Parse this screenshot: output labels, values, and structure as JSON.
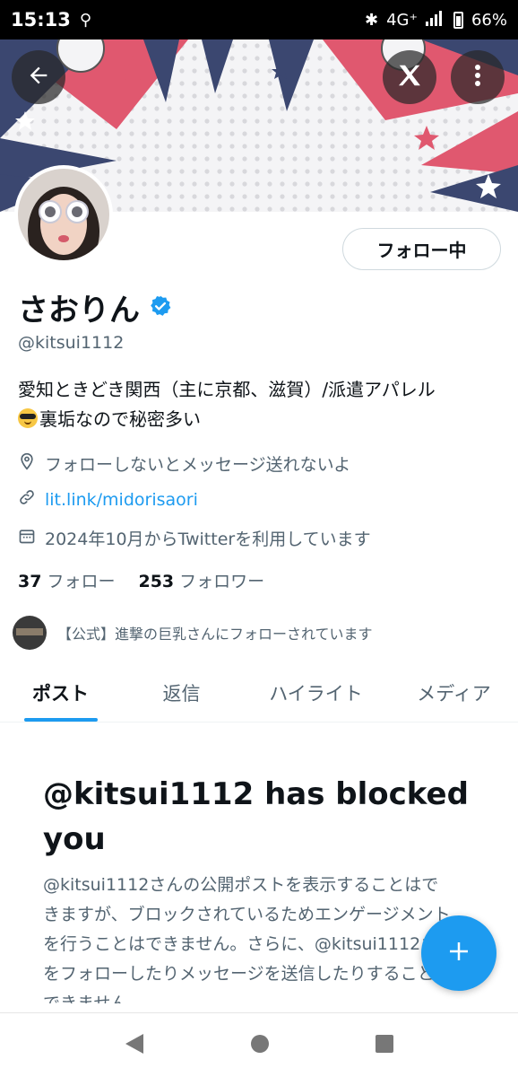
{
  "status_bar": {
    "time": "15:13",
    "network": "4G⁺",
    "battery": "66%"
  },
  "profile": {
    "name": "さおりん",
    "handle": "@kitsui1112",
    "follow_button": "フォロー中",
    "bio_line1": "愛知ときどき関西（主に京都、滋賀）/派遣アパレル",
    "bio_line2": "裏垢なので秘密多い",
    "location": "フォローしないとメッセージ送れないよ",
    "link": "lit.link/midorisaori",
    "joined": "2024年10月からTwitterを利用しています",
    "following_count": "37",
    "following_label": "フォロー",
    "followers_count": "253",
    "followers_label": "フォロワー",
    "followed_by": "【公式】進撃の巨乳さんにフォローされています"
  },
  "tabs": [
    {
      "label": "ポスト",
      "active": true
    },
    {
      "label": "返信",
      "active": false
    },
    {
      "label": "ハイライト",
      "active": false
    },
    {
      "label": "メディア",
      "active": false
    }
  ],
  "blocked": {
    "title": "@kitsui1112 has blocked you",
    "body": "@kitsui1112さんの公開ポストを表示することはできますが、ブロックされているためエンゲージメントを行うことはできません。さらに、@kitsui1112さんをフォローしたりメッセージを送信したりすることもできません。"
  },
  "colors": {
    "accent": "#1d9bf0",
    "text_primary": "#0f1419",
    "text_secondary": "#536471",
    "banner_pink": "#e0586f",
    "banner_navy": "#3b4770"
  },
  "icons": {
    "back": "arrow-left-icon",
    "x_logo": "x-logo-icon",
    "more": "more-vertical-icon",
    "verified": "verified-badge-icon",
    "location": "location-pin-icon",
    "link": "link-icon",
    "calendar": "calendar-icon",
    "compose": "plus-icon"
  }
}
